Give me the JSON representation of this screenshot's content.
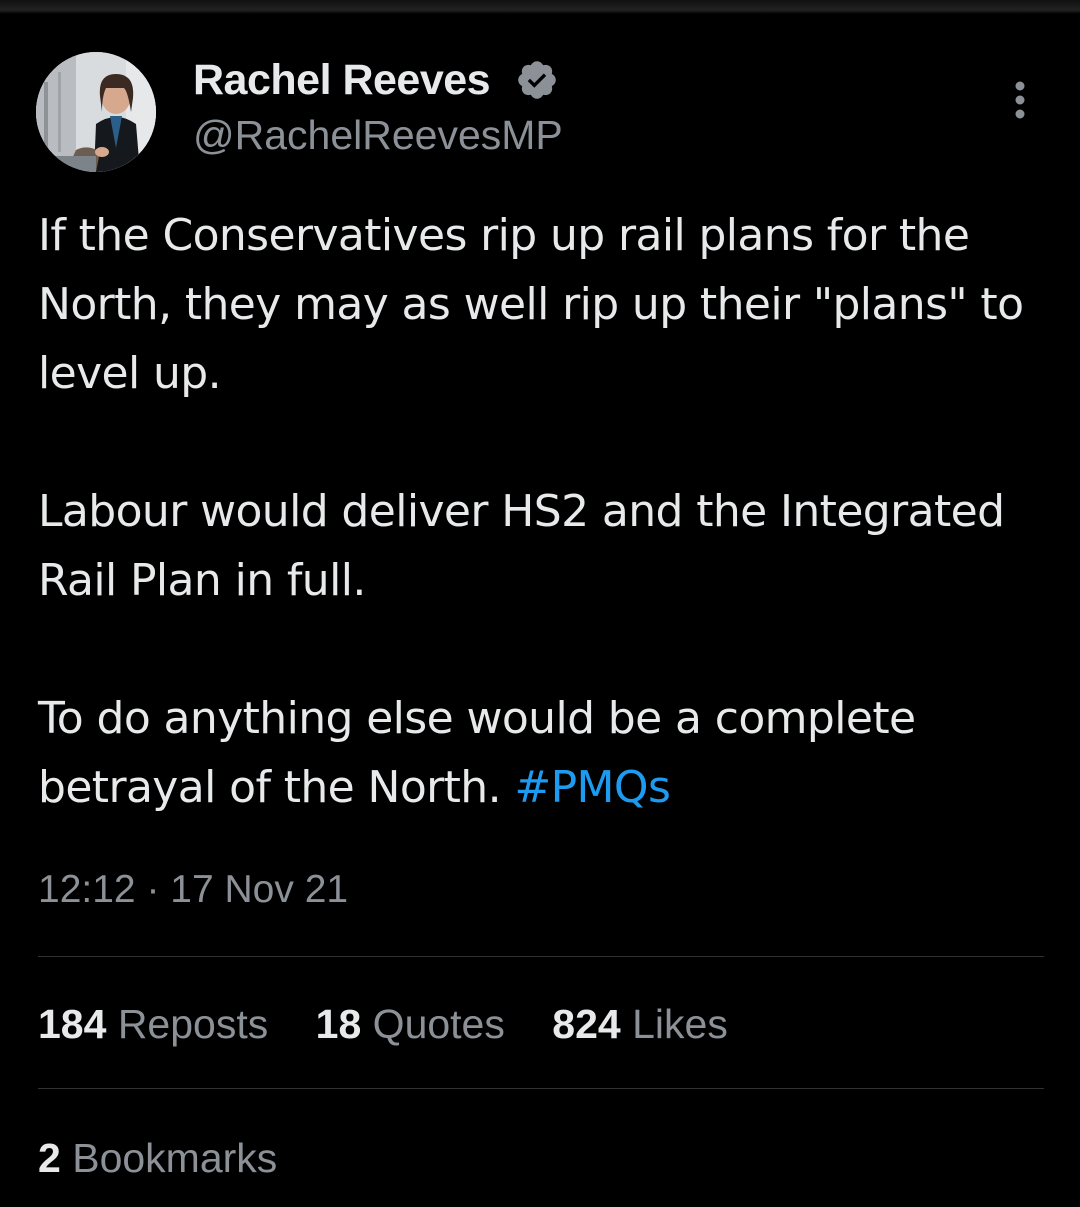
{
  "author": {
    "display_name": "Rachel Reeves",
    "handle": "@RachelReevesMP",
    "verified_icon": "verified-badge-icon",
    "verified_color": "#8b9197"
  },
  "menu": {
    "icon": "more-vertical-icon"
  },
  "tweet": {
    "paragraphs": [
      "If the Conservatives rip up rail plans for the North, they may as well rip up their \"plans\" to level up.",
      "Labour would deliver HS2 and the Integrated Rail Plan in full."
    ],
    "last_paragraph_text": "To do anything else would be a complete betrayal of the North.",
    "hashtag": "#PMQs"
  },
  "meta": {
    "time": "12:12",
    "separator": "·",
    "date": "17 Nov 21"
  },
  "stats": {
    "reposts_count": "184",
    "reposts_label": "Reposts",
    "quotes_count": "18",
    "quotes_label": "Quotes",
    "likes_count": "824",
    "likes_label": "Likes"
  },
  "bookmarks": {
    "count": "2",
    "label": "Bookmarks"
  },
  "colors": {
    "background": "#000000",
    "text": "#e7e9ea",
    "secondary": "#8b9197",
    "link": "#1d9bf0",
    "divider": "#2f3336"
  }
}
